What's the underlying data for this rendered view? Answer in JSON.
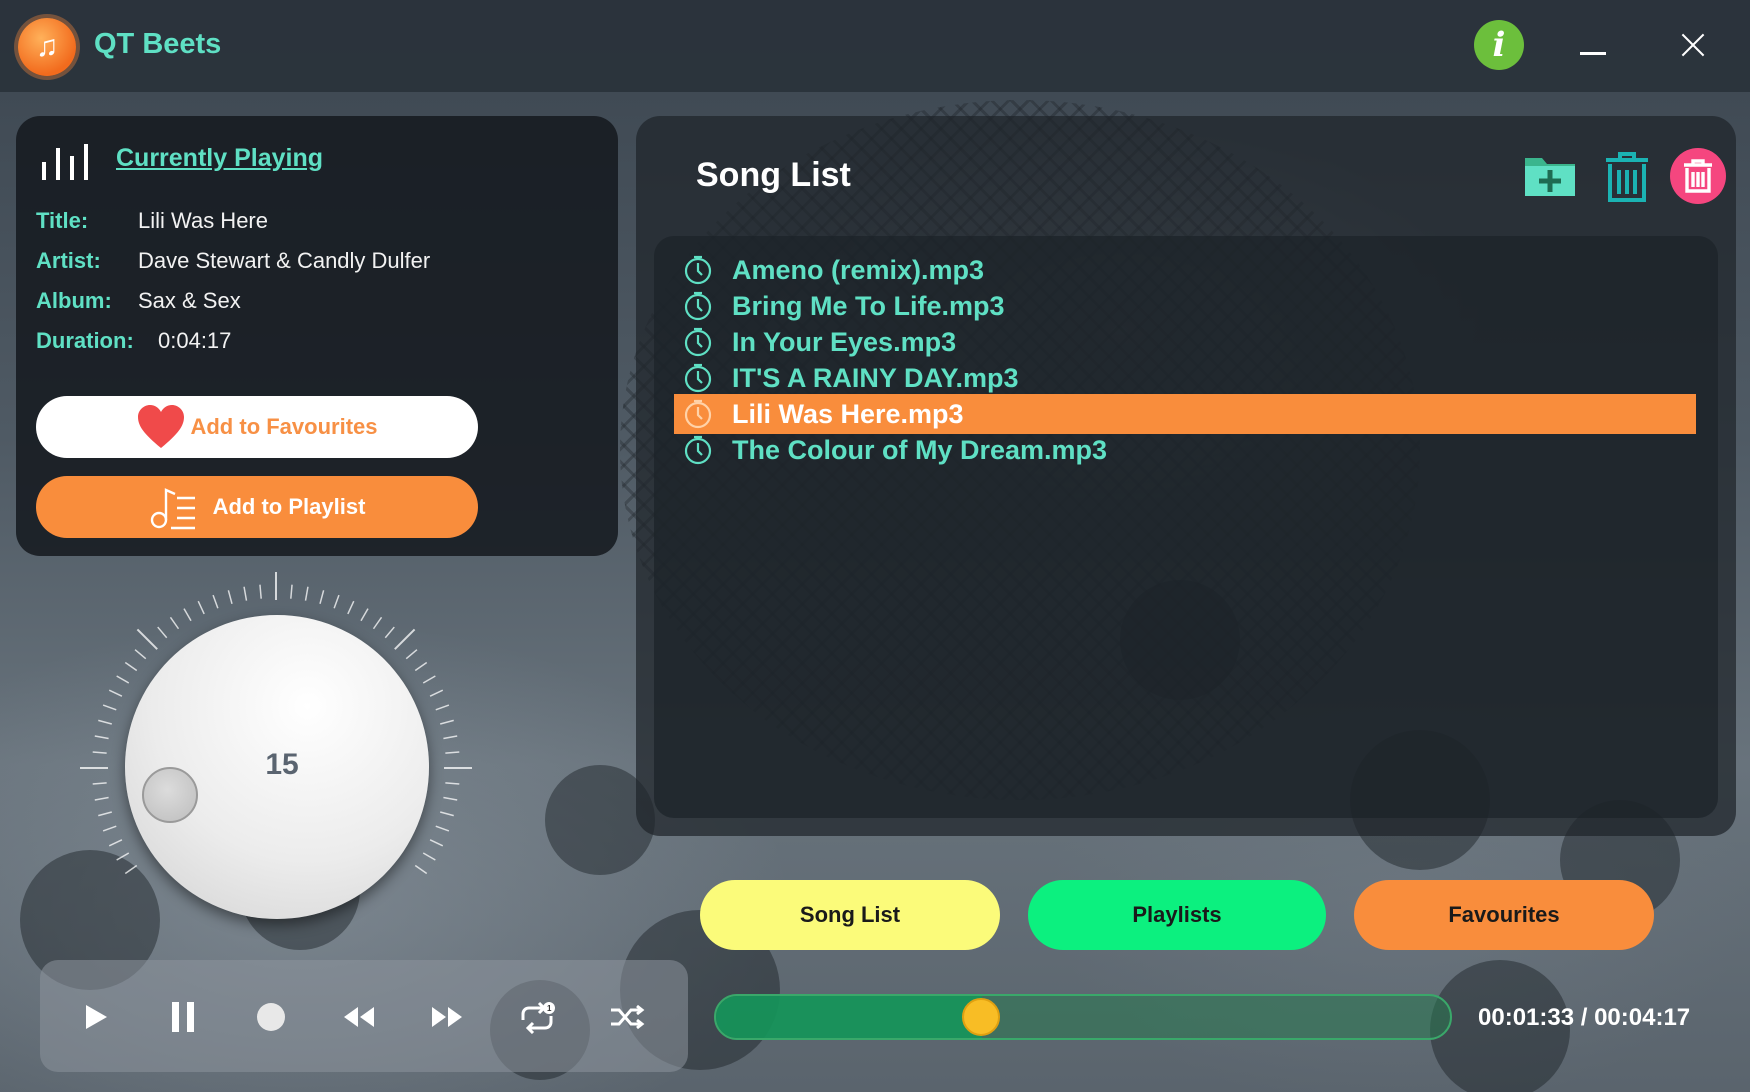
{
  "app": {
    "title": "QT Beets",
    "logo_icon": "music-note-icon",
    "accent_color": "#5fe0c4"
  },
  "window_controls": {
    "info_label": "i",
    "minimize_icon": "minimize-icon",
    "close_icon": "close-icon"
  },
  "now_playing": {
    "heading": "Currently Playing",
    "icon": "equalizer-bars-icon",
    "fields": [
      {
        "key": "Title:",
        "value": "Lili Was Here"
      },
      {
        "key": "Artist:",
        "value": "Dave Stewart & Candly Dulfer"
      },
      {
        "key": "Album:",
        "value": "Sax & Sex"
      },
      {
        "key": "Duration:",
        "value": "0:04:17"
      }
    ],
    "favourite_button": "Add to Favourites",
    "playlist_button": "Add to Playlist"
  },
  "volume": {
    "value": "15",
    "level": 0.15
  },
  "transport": {
    "buttons": [
      "play-icon",
      "pause-icon",
      "stop-icon",
      "rewind-icon",
      "fast-forward-icon",
      "repeat-one-icon",
      "shuffle-icon"
    ]
  },
  "song_list": {
    "title": "Song List",
    "actions": [
      "add-folder-icon",
      "trash-icon",
      "delete-all-icon"
    ],
    "songs": [
      {
        "name": "Ameno (remix).mp3",
        "active": false
      },
      {
        "name": "Bring Me To Life.mp3",
        "active": false
      },
      {
        "name": "In Your Eyes.mp3",
        "active": false
      },
      {
        "name": "IT'S A RAINY DAY.mp3",
        "active": false
      },
      {
        "name": "Lili Was Here.mp3",
        "active": true
      },
      {
        "name": "The Colour of My Dream.mp3",
        "active": false
      }
    ],
    "highlight_color": "#f98d3c"
  },
  "tabs": {
    "song_list": "Song List",
    "playlists": "Playlists",
    "favourites": "Favourites"
  },
  "playback": {
    "time": "00:01:33 / 00:04:17",
    "progress": 0.362
  }
}
